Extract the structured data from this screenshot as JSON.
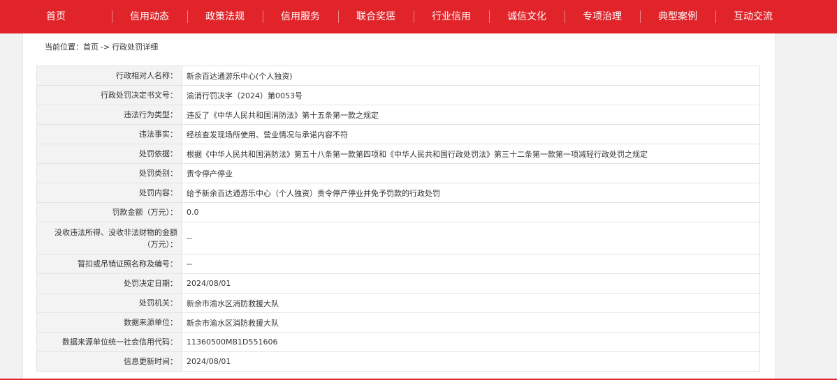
{
  "nav": {
    "items": [
      {
        "label": "首页"
      },
      {
        "label": "信用动态"
      },
      {
        "label": "政策法规"
      },
      {
        "label": "信用服务"
      },
      {
        "label": "联合奖惩"
      },
      {
        "label": "行业信用"
      },
      {
        "label": "诚信文化"
      },
      {
        "label": "专项治理"
      },
      {
        "label": "典型案例"
      },
      {
        "label": "互动交流"
      }
    ]
  },
  "breadcrumb": {
    "prefix": "当前位置：",
    "home": "首页",
    "separator": "->",
    "current": "行政处罚详细"
  },
  "detail": {
    "rows": [
      {
        "label": "行政相对人名称：",
        "value": "新余百达通游乐中心(个人独资)"
      },
      {
        "label": "行政处罚决定书文号：",
        "value": "渝消行罚决字（2024）第0053号"
      },
      {
        "label": "违法行为类型：",
        "value": "违反了《中华人民共和国消防法》第十五条第一款之规定"
      },
      {
        "label": "违法事实：",
        "value": "经核查发现场所使用、营业情况与承诺内容不符"
      },
      {
        "label": "处罚依据：",
        "value": "根据《中华人民共和国消防法》第五十八条第一款第四项和《中华人民共和国行政处罚法》第三十二条第一款第一项减轻行政处罚之规定"
      },
      {
        "label": "处罚类别：",
        "value": "责令停产停业"
      },
      {
        "label": "处罚内容：",
        "value": "给予新余百达通游乐中心（个人独资）责令停产停业并免予罚款的行政处罚"
      },
      {
        "label": "罚款金额（万元）：",
        "value": "0.0"
      },
      {
        "label": "没收违法所得、没收非法财物的金额（万元）：",
        "value": "--"
      },
      {
        "label": "暂扣或吊销证照名称及编号：",
        "value": "--"
      },
      {
        "label": "处罚决定日期：",
        "value": "2024/08/01"
      },
      {
        "label": "处罚机关：",
        "value": "新余市渝水区消防救援大队"
      },
      {
        "label": "数据来源单位：",
        "value": "新余市渝水区消防救援大队"
      },
      {
        "label": "数据来源单位统一社会信用代码：",
        "value": "11360500MB1D551606"
      },
      {
        "label": "信息更新时间：",
        "value": "2024/08/01"
      }
    ]
  },
  "colors": {
    "brand_red": "#e0242a",
    "page_bg": "#f2f2f2",
    "label_bg": "#f3f3f3",
    "border": "#dfe3ea"
  }
}
